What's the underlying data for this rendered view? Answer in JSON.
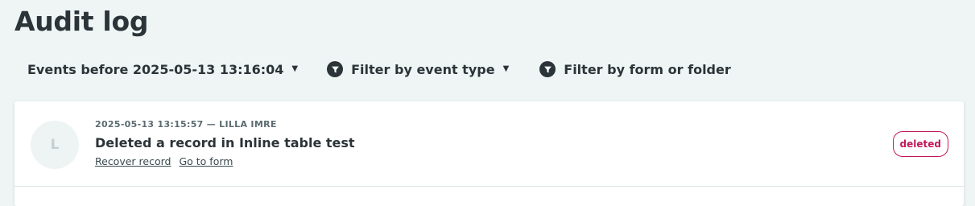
{
  "page": {
    "title": "Audit log"
  },
  "toolbar": {
    "date_filter_label": "Events before 2025-05-13 13:16:04",
    "event_type_filter_label": "Filter by event type",
    "form_folder_filter_label": "Filter by form or folder",
    "caret_icon": "caret-down-icon",
    "filter_icon": "funnel-icon"
  },
  "events": [
    {
      "avatar_initial": "L",
      "meta": "2025-05-13 13:15:57 — LILLA IMRE",
      "description": "Deleted a record in Inline table test",
      "links": [
        "Recover record",
        "Go to form"
      ],
      "badge": "deleted",
      "badge_color": "#c2185b"
    }
  ]
}
